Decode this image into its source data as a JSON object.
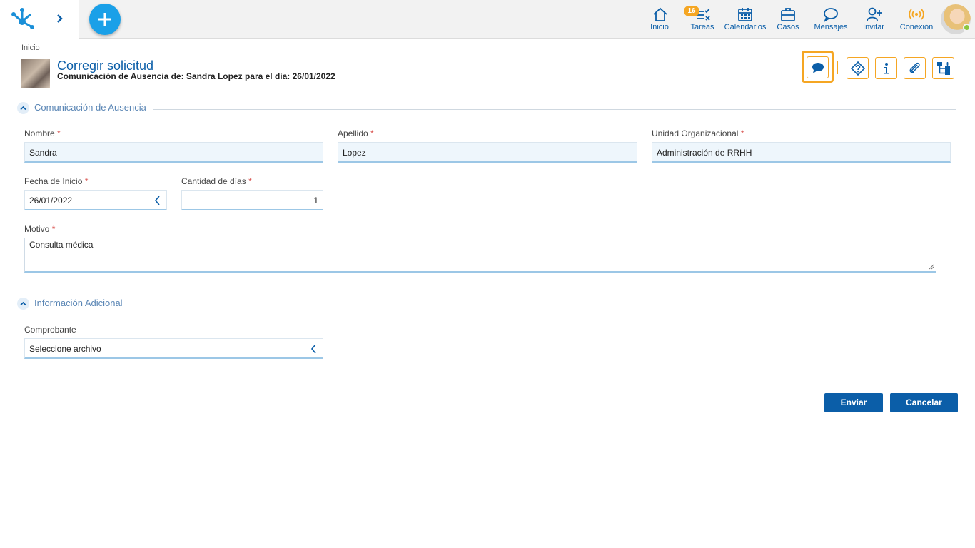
{
  "topbar": {
    "nav": [
      {
        "id": "inicio",
        "label": "Inicio",
        "icon": "home-icon"
      },
      {
        "id": "tareas",
        "label": "Tareas",
        "icon": "tasks-icon"
      },
      {
        "id": "calendarios",
        "label": "Calendarios",
        "icon": "calendar-icon"
      },
      {
        "id": "casos",
        "label": "Casos",
        "icon": "briefcase-icon"
      },
      {
        "id": "mensajes",
        "label": "Mensajes",
        "icon": "chat-icon"
      },
      {
        "id": "invitar",
        "label": "Invitar",
        "icon": "add-user-icon"
      },
      {
        "id": "conexion",
        "label": "Conexión",
        "icon": "wifi-signal-icon"
      }
    ],
    "tasks_badge": "16",
    "accent_color": "#0b5ea8",
    "badge_color": "#f5a623",
    "status_color": "#8cc63f"
  },
  "breadcrumb": "Inicio",
  "page": {
    "title": "Corregir solicitud",
    "subtitle": "Comunicación de Ausencia de: Sandra Lopez para el día: 26/01/2022"
  },
  "toolbar": [
    "comment-icon",
    "help-icon",
    "info-icon",
    "attachment-icon",
    "process-map-icon"
  ],
  "sections": {
    "ausencia": "Comunicación de Ausencia",
    "adicional": "Información Adicional"
  },
  "fields": {
    "nombre": {
      "label": "Nombre",
      "value": "Sandra"
    },
    "apellido": {
      "label": "Apellido",
      "value": "Lopez"
    },
    "unidad": {
      "label": "Unidad Organizacional",
      "value": "Administración de RRHH"
    },
    "fecha": {
      "label": "Fecha de Inicio",
      "value": "26/01/2022"
    },
    "cantidad": {
      "label": "Cantidad de días",
      "value": "1"
    },
    "motivo": {
      "label": "Motivo",
      "value": "Consulta médica"
    },
    "comprobante": {
      "label": "Comprobante",
      "value": "Seleccione archivo"
    }
  },
  "required_mark": "*",
  "actions": {
    "enviar": "Enviar",
    "cancelar": "Cancelar"
  }
}
